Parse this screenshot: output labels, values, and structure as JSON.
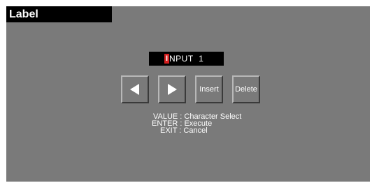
{
  "header": {
    "title": "Label"
  },
  "editor": {
    "cursor_char": "I",
    "remaining_text": "NPUT  1"
  },
  "buttons": {
    "left_icon": "left-arrow-icon",
    "right_icon": "right-arrow-icon",
    "insert_label": "Insert",
    "delete_label": "Delete"
  },
  "help": {
    "line1": "VALUE : Character Select",
    "line2": "ENTER : Execute",
    "line3": "EXIT : Cancel"
  },
  "colors": {
    "background": "#7a7a7a",
    "title_bar": "#000000",
    "cursor": "#d41e1e",
    "text": "#ffffff"
  }
}
